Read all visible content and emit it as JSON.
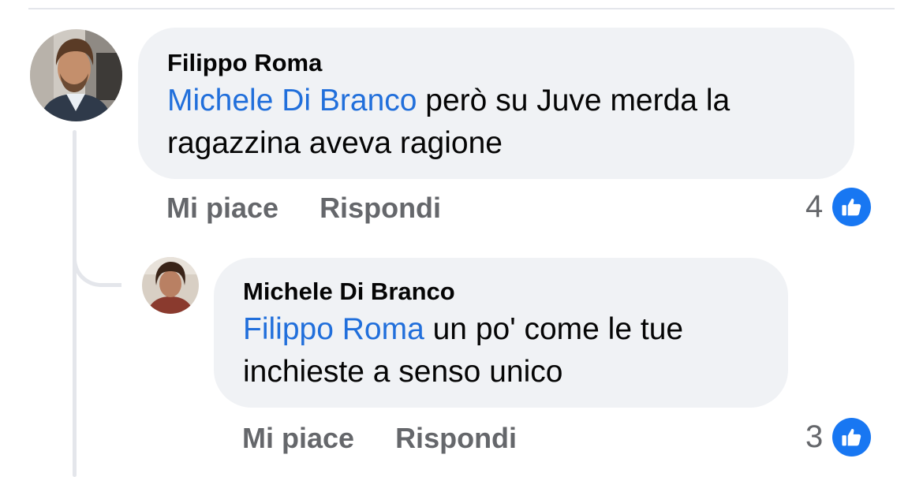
{
  "comments": [
    {
      "author": "Filippo Roma",
      "mention": "Michele Di Branco",
      "text_line1": " però su Juve merda la",
      "text_line2": "ragazzina aveva ragione",
      "like_label": "Mi piace",
      "reply_label": "Rispondi",
      "reaction_count": "4",
      "reaction_icon": "thumbs-up-icon"
    },
    {
      "author": "Michele Di Branco",
      "mention": "Filippo Roma",
      "text_line1": " un po' come le tue",
      "text_line2": "inchieste a senso unico",
      "like_label": "Mi piace",
      "reply_label": "Rispondi",
      "reaction_count": "3",
      "reaction_icon": "thumbs-up-icon"
    }
  ],
  "colors": {
    "bubble": "#f0f2f5",
    "mention": "#216fdb",
    "secondary_text": "#65676b",
    "like_badge": "#1877f2",
    "thread_line": "#e4e6eb"
  }
}
